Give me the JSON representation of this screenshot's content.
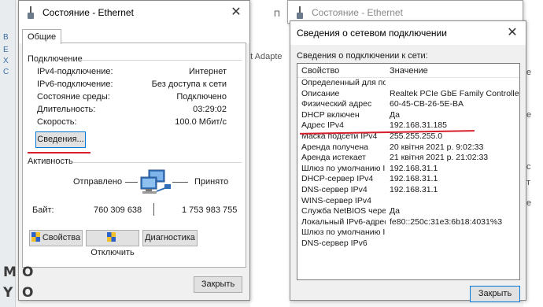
{
  "background": {
    "left_fragments": [
      "B",
      "E",
      "X",
      "C"
    ],
    "mid_text_top": "П",
    "mid_text_adapter": "et Adapte",
    "right_fragments": [
      "е",
      "е",
      "с",
      "т",
      "е"
    ]
  },
  "status_window": {
    "title": "Состояние - Ethernet",
    "tab": "Общие",
    "connection_group": "Подключение",
    "rows": [
      {
        "label": "IPv4-подключение:",
        "value": "Интернет"
      },
      {
        "label": "IPv6-подключение:",
        "value": "Без доступа к сети"
      },
      {
        "label": "Состояние среды:",
        "value": "Подключено"
      },
      {
        "label": "Длительность:",
        "value": "03:29:02"
      },
      {
        "label": "Скорость:",
        "value": "100.0 Мбит/с"
      }
    ],
    "details_button": "Сведения...",
    "activity_group": "Активность",
    "sent_label": "Отправлено",
    "received_label": "Принято",
    "bytes_label": "Байт:",
    "bytes_sent": "760 309 638",
    "bytes_received": "1 753 983 755",
    "properties_button": "Свойства",
    "disable_button": "Отключить",
    "diagnose_button": "Диагностика",
    "close_button": "Закрыть",
    "accent_color": "#d61f2b"
  },
  "details_window": {
    "bg_title": "Состояние - Ethernet",
    "title": "Сведения о сетевом подключении",
    "caption": "Сведения о подключении к сети:",
    "col_property": "Свойство",
    "col_value": "Значение",
    "rows": [
      {
        "prop": "Определенный для по...",
        "val": ""
      },
      {
        "prop": "Описание",
        "val": "Realtek PCIe GbE Family Controller"
      },
      {
        "prop": "Физический адрес",
        "val": "60-45-CB-26-5E-BA"
      },
      {
        "prop": "DHCP включен",
        "val": "Да"
      },
      {
        "prop": "Адрес IPv4",
        "val": "192.168.31.185"
      },
      {
        "prop": "Маска подсети IPv4",
        "val": "255.255.255.0"
      },
      {
        "prop": "Аренда получена",
        "val": "20 квітня 2021 р. 9:02:33"
      },
      {
        "prop": "Аренда истекает",
        "val": "21 квітня 2021 р. 21:02:33"
      },
      {
        "prop": "Шлюз по умолчанию IP...",
        "val": "192.168.31.1"
      },
      {
        "prop": "DHCP-сервер IPv4",
        "val": "192.168.31.1"
      },
      {
        "prop": "DNS-сервер IPv4",
        "val": "192.168.31.1"
      },
      {
        "prop": "WINS-сервер IPv4",
        "val": ""
      },
      {
        "prop": "Служба NetBIOS черeз...",
        "val": "Да"
      },
      {
        "prop": "Локальный IPv6-адрес...",
        "val": "fe80::250c:31e3:6b18:4031%3"
      },
      {
        "prop": "Шлюз по умолчанию IP...",
        "val": ""
      },
      {
        "prop": "DNS-сервер IPv6",
        "val": ""
      }
    ],
    "close_button": "Закрыть"
  },
  "watermark": {
    "letters": [
      "M",
      "O",
      "Y",
      "O"
    ]
  }
}
